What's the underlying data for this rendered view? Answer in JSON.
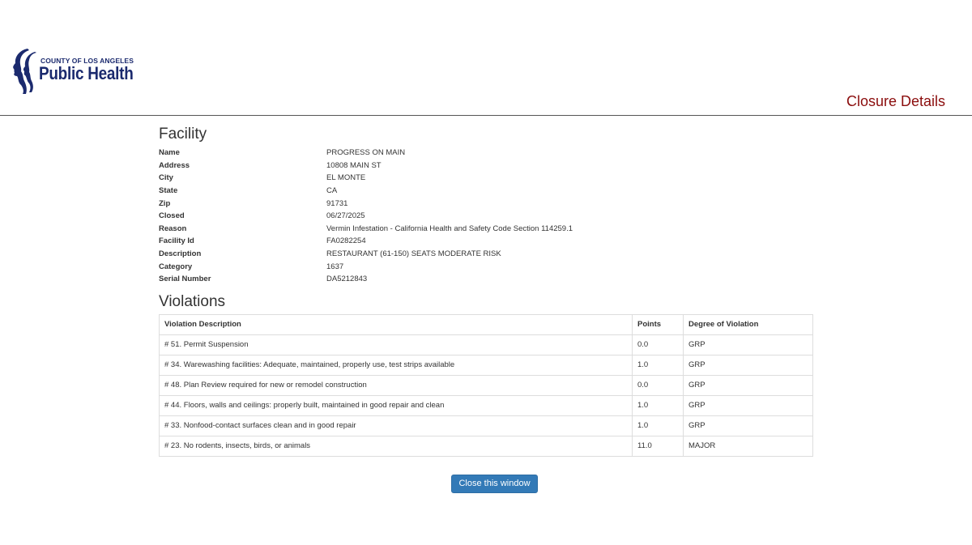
{
  "logo": {
    "county": "COUNTY OF LOS ANGELES",
    "main": "Public Health"
  },
  "page_title": "Closure Details",
  "facility": {
    "heading": "Facility",
    "fields": [
      {
        "label": "Name",
        "value": "PROGRESS ON MAIN"
      },
      {
        "label": "Address",
        "value": "10808 MAIN ST"
      },
      {
        "label": "City",
        "value": "EL MONTE"
      },
      {
        "label": "State",
        "value": "CA"
      },
      {
        "label": "Zip",
        "value": "91731"
      },
      {
        "label": "Closed",
        "value": "06/27/2025"
      },
      {
        "label": "Reason",
        "value": "Vermin Infestation - California Health and Safety Code Section 114259.1"
      },
      {
        "label": "Facility Id",
        "value": "FA0282254"
      },
      {
        "label": "Description",
        "value": "RESTAURANT (61-150) SEATS MODERATE RISK"
      },
      {
        "label": "Category",
        "value": "1637"
      },
      {
        "label": "Serial Number",
        "value": "DA5212843"
      }
    ]
  },
  "violations": {
    "heading": "Violations",
    "columns": [
      "Violation Description",
      "Points",
      "Degree of Violation"
    ],
    "rows": [
      [
        "# 51. Permit Suspension",
        "0.0",
        "GRP"
      ],
      [
        "# 34. Warewashing facilities: Adequate, maintained, properly use, test strips available",
        "1.0",
        "GRP"
      ],
      [
        "# 48. Plan Review required for new or remodel construction",
        "0.0",
        "GRP"
      ],
      [
        "# 44. Floors, walls and ceilings: properly built, maintained in good repair and clean",
        "1.0",
        "GRP"
      ],
      [
        "# 33. Nonfood-contact surfaces clean and in good repair",
        "1.0",
        "GRP"
      ],
      [
        "# 23. No rodents, insects, birds, or animals",
        "11.0",
        "MAJOR"
      ]
    ]
  },
  "close_button": "Close this window",
  "colors": {
    "title": "#8b0d0d",
    "logo": "#1b2a6e",
    "button": "#337ab7"
  }
}
